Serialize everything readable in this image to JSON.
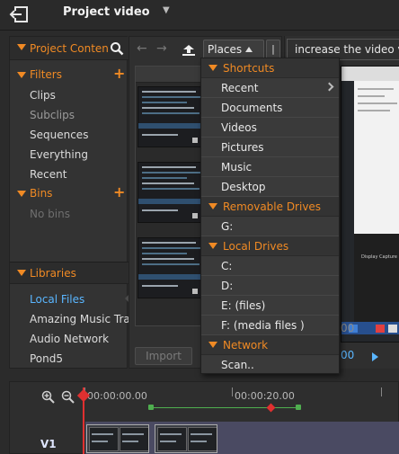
{
  "header": {
    "project_title": "Project video"
  },
  "left_panel": {
    "header_label": "Project Content",
    "filters_label": "Filters",
    "filters": [
      "Clips",
      "Subclips",
      "Sequences",
      "Everything",
      "Recent"
    ],
    "bins_label": "Bins",
    "bins_empty": "No bins",
    "libraries_label": "Libraries",
    "libraries": [
      "Local Files",
      "Amazing Music Tracks",
      "Audio Network",
      "Pond5"
    ]
  },
  "browser": {
    "places_label": "Places",
    "places_extra": "|",
    "import_label": "Import"
  },
  "search": {
    "value": "increase the video volume"
  },
  "preview": {
    "caption": "Display Capture",
    "timecode_a": "00",
    "timecode_b": "00"
  },
  "dropdown": {
    "shortcuts_label": "Shortcuts",
    "shortcuts": [
      "Recent",
      "Documents",
      "Videos",
      "Pictures",
      "Music",
      "Desktop"
    ],
    "removable_label": "Removable Drives",
    "removable": [
      "G:"
    ],
    "local_label": "Local Drives",
    "local": [
      "C:",
      "D:",
      "E: (files)",
      "F: (media files )"
    ],
    "network_label": "Network",
    "network": [
      "Scan.."
    ]
  },
  "timeline": {
    "tc_start": "00:00:00.00",
    "tc_mid": "00:00:20.00",
    "track_label": "V1"
  },
  "colors": {
    "accent_orange": "#f08a24",
    "accent_blue": "#5ab6ff",
    "playhead_red": "#e03030",
    "marker_green": "#4fae4f"
  }
}
